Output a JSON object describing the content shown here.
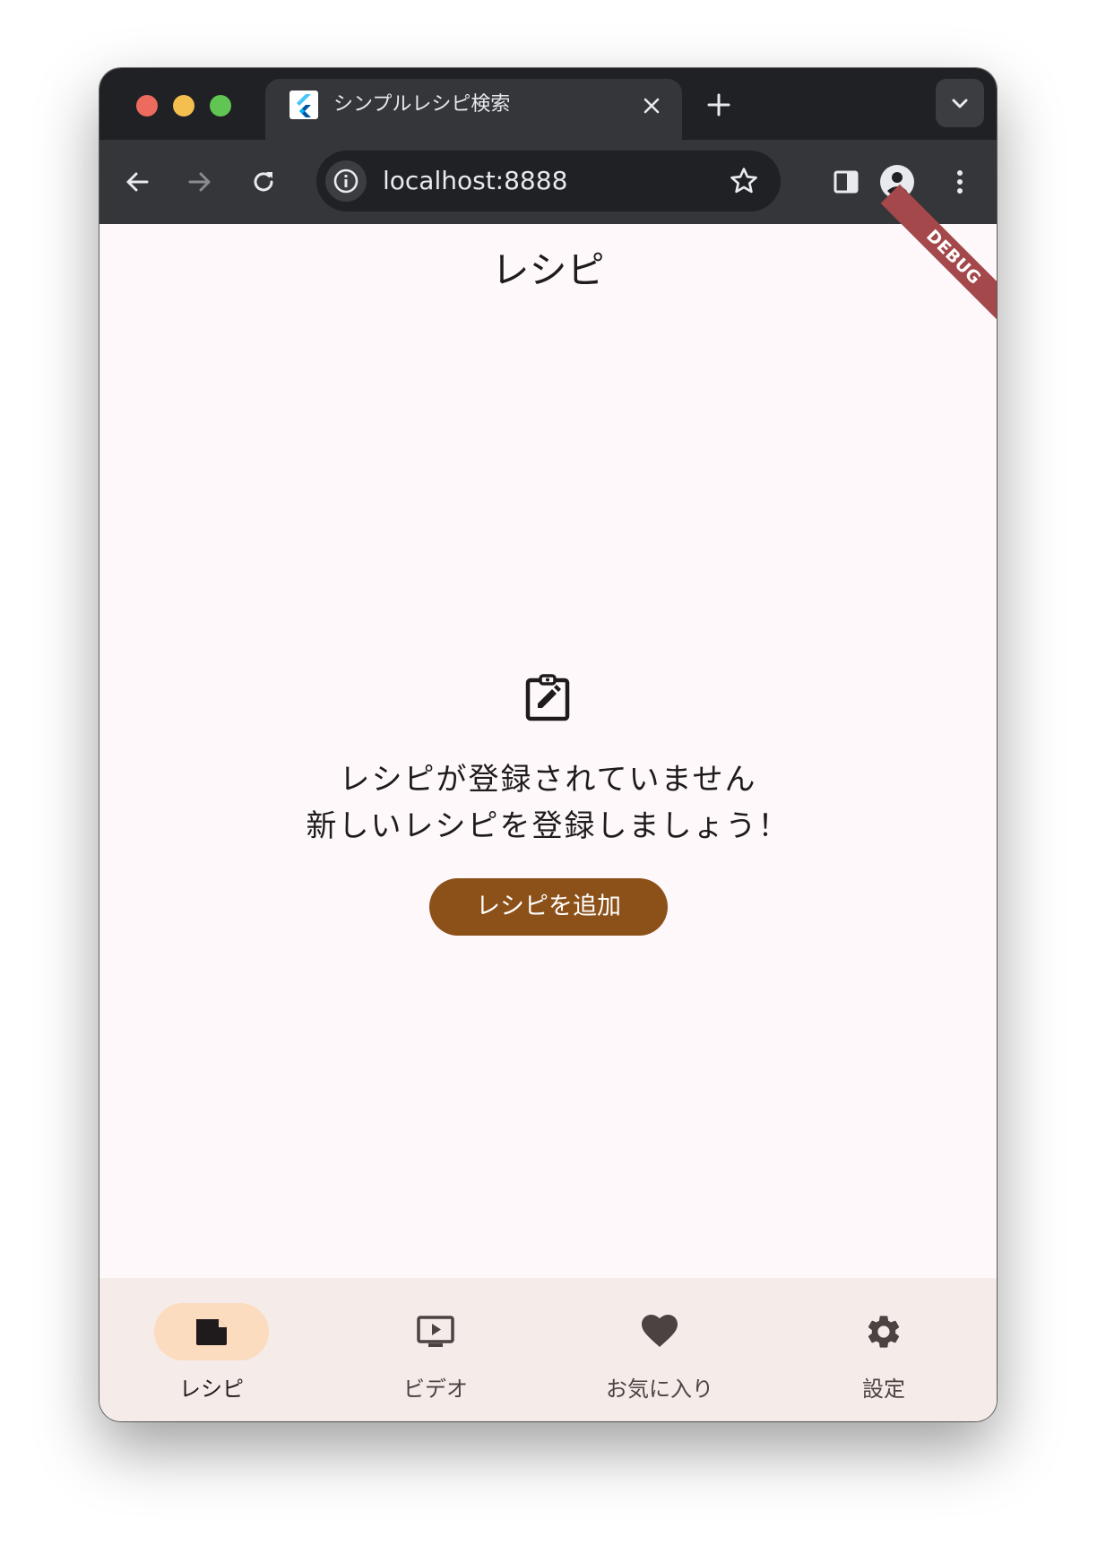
{
  "browser": {
    "tab_title": "シンプルレシピ検索",
    "url": "localhost:8888"
  },
  "app": {
    "title": "レシピ",
    "debug_banner": "DEBUG",
    "empty_state": {
      "line1": "レシピが登録されていません",
      "line2": "新しいレシピを登録しましょう！",
      "button_label": "レシピを追加",
      "icon": "assignment-edit-icon"
    }
  },
  "bottom_nav": {
    "active_index": 0,
    "items": [
      {
        "label": "レシピ",
        "icon": "recipe-icon"
      },
      {
        "label": "ビデオ",
        "icon": "video-icon"
      },
      {
        "label": "お気に入り",
        "icon": "heart-icon"
      },
      {
        "label": "設定",
        "icon": "gear-icon"
      }
    ]
  },
  "colors": {
    "accent": "#8b5119",
    "nav_active_pill": "#fbdcbf",
    "nav_background": "#f5ebe9",
    "content_background": "#fef8fb",
    "debug_banner": "#a4484b"
  }
}
